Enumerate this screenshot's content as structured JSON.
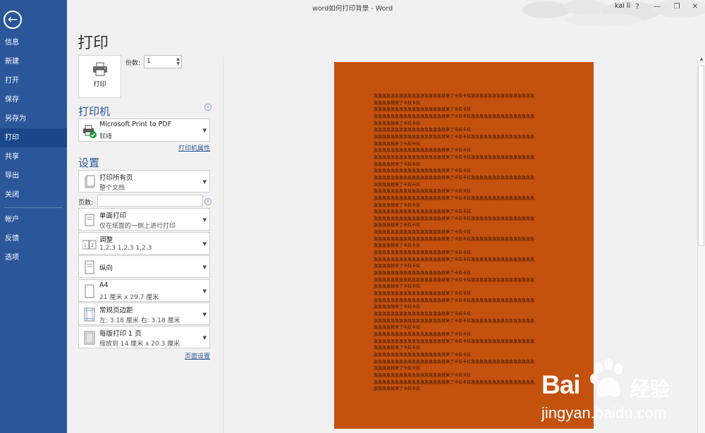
{
  "window": {
    "title": "word如何打印背景 - Word",
    "user": "kai li",
    "help": "?",
    "minimize": "—",
    "restore": "❐",
    "close": "✕"
  },
  "sidebar": {
    "back_icon": "back-arrow-icon",
    "items": [
      {
        "label": "信息"
      },
      {
        "label": "新建"
      },
      {
        "label": "打开"
      },
      {
        "label": "保存"
      },
      {
        "label": "另存为"
      },
      {
        "label": "打印",
        "active": true
      },
      {
        "label": "共享"
      },
      {
        "label": "导出"
      },
      {
        "label": "关闭"
      },
      {
        "label": "帐户"
      },
      {
        "label": "反馈"
      },
      {
        "label": "选项"
      }
    ],
    "colors": {
      "bg": "#2b579a",
      "active": "#19478a"
    }
  },
  "print": {
    "heading": "打印",
    "button_label": "打印",
    "copies_label": "份数:",
    "copies_value": "1",
    "printer_heading": "打印机",
    "printer_name": "Microsoft Print to PDF",
    "printer_status": "就绪",
    "printer_props_link": "打印机属性",
    "settings_heading": "设置",
    "pages_label": "页数:",
    "pages_value": "",
    "page_setup_link": "页面设置",
    "settings": [
      {
        "title": "打印所有页",
        "sub": "整个文档",
        "icon": "pages-icon"
      },
      {
        "title": "单面打印",
        "sub": "仅在纸面的一侧上进行打印",
        "icon": "one-sided-icon"
      },
      {
        "title": "调整",
        "sub": "1,2,3    1,2,3    1,2,3",
        "icon": "collate-icon"
      },
      {
        "title": "纵向",
        "sub": "",
        "icon": "portrait-icon"
      },
      {
        "title": "A4",
        "sub": "21 厘米 x 29.7 厘米",
        "icon": "paper-size-icon"
      },
      {
        "title": "常规页边距",
        "sub": "左: 3.18 厘米    右: 3.18 厘米",
        "icon": "margins-icon"
      },
      {
        "title": "每版打印 1 页",
        "sub": "缩放到 14 厘米 x 20.3 厘米",
        "icon": "pages-per-sheet-icon"
      }
    ]
  },
  "preview": {
    "background": "#c4510e",
    "lines": [
      "急急急急急急急急急急急急急急急急就来了卡拉卡拉急急急急急急急急急急急急急急急",
      "急急急急就来了卡拉卡拉",
      "急急急急急急急急急急急急急急急急就来了卡拉卡拉",
      "急急急急急急急急急急急急急急急急就来了卡拉卡拉急急急急急急急急急急急急急急急",
      "急急急急就来了卡拉卡拉",
      "急急急急急急急急急急急急急急急急就来了卡拉卡拉",
      "急急急急急急急急急急急急急急急急就来了卡拉卡拉急急急急急急急急急急急急急急急",
      "急急急急就来了卡拉卡拉",
      "急急急急急急急急急急急急急急急急就来了卡拉卡拉",
      "急急急急急急急急急急急急急急急急就来了卡拉卡拉急急急急急急急急急急急急急急急",
      "急急急急就来了卡拉卡拉",
      "急急急急急急急急急急急急急急急急就来了卡拉卡拉",
      "急急急急急急急急急急急急急急急急就来了卡拉卡拉急急急急急急急急急急急急急急急",
      "急急急急就来了卡拉卡拉",
      "急急急急急急急急急急急急急急急急就来了卡拉卡拉",
      "急急急急急急急急急急急急急急急急就来了卡拉卡拉急急急急急急急急急急急急急急急",
      "急急急急就来了卡拉卡拉",
      "急急急急急急急急急急急急急急急急就来了卡拉卡拉",
      "急急急急急急急急急急急急急急急急就来了卡拉卡拉急急急急急急急急急急急急急急急",
      "急急急急就来了卡拉卡拉",
      "急急急急急急急急急急急急急急急急就来了卡拉卡拉",
      "急急急急急急急急急急急急急急急急就来了卡拉卡拉急急急急急急急急急急急急急急急",
      "急急急急就来了卡拉卡拉",
      "急急急急急急急急急急急急急急急急就来了卡拉卡拉",
      "急急急急急急急急急急急急急急急急就来了卡拉卡拉急急急急急急急急急急急急急急急",
      "急急急急就来了卡拉卡拉",
      "急急急急急急急急急急急急急急急急就来了卡拉卡拉",
      "急急急急急急急急急急急急急急急急就来了卡拉卡拉急急急急急急急急急急急急急急急",
      "急急急急就来了卡拉卡拉",
      "急急急急急急急急急急急急急急急急就来了卡拉卡拉",
      "急急急急急急急急急急急急急急急急就来了卡拉卡拉急急急急急急急急急急急急急急急",
      "急急急急就来了卡拉卡拉",
      "急急急急急急急急急急急急急急急急就来了卡拉卡拉",
      "急急急急急急急急急急急急急急急急就来了卡拉卡拉急急急急急急急急急急急急急急急",
      "急急急急就来了卡拉卡拉",
      "急急急急急急急急急急急急急急急急就来了卡拉卡拉",
      "急急急急急急急急急急急急急急急急就来了卡拉卡拉急急急急急急急急急急急急急急急",
      "急急急急就来了卡拉卡拉",
      "急急急急急急急急急急急急急急急急就来了卡拉卡拉",
      "急急急急急急急急急急急急急急急急就来了卡拉卡拉急急急急急急急急急急急急急急急",
      "急急急急就来了卡拉卡拉",
      "急急急急急急急急急急急急急急急急就来了卡拉卡拉",
      "急急急急急急急急急急急急急急急急就来了卡拉卡拉急急急急急急急急急急急急急急急",
      "急急急急就来了卡拉卡拉"
    ]
  },
  "watermark": {
    "brand": "Bai",
    "brand_suffix": "经验",
    "url": "jingyan.baidu.com"
  }
}
